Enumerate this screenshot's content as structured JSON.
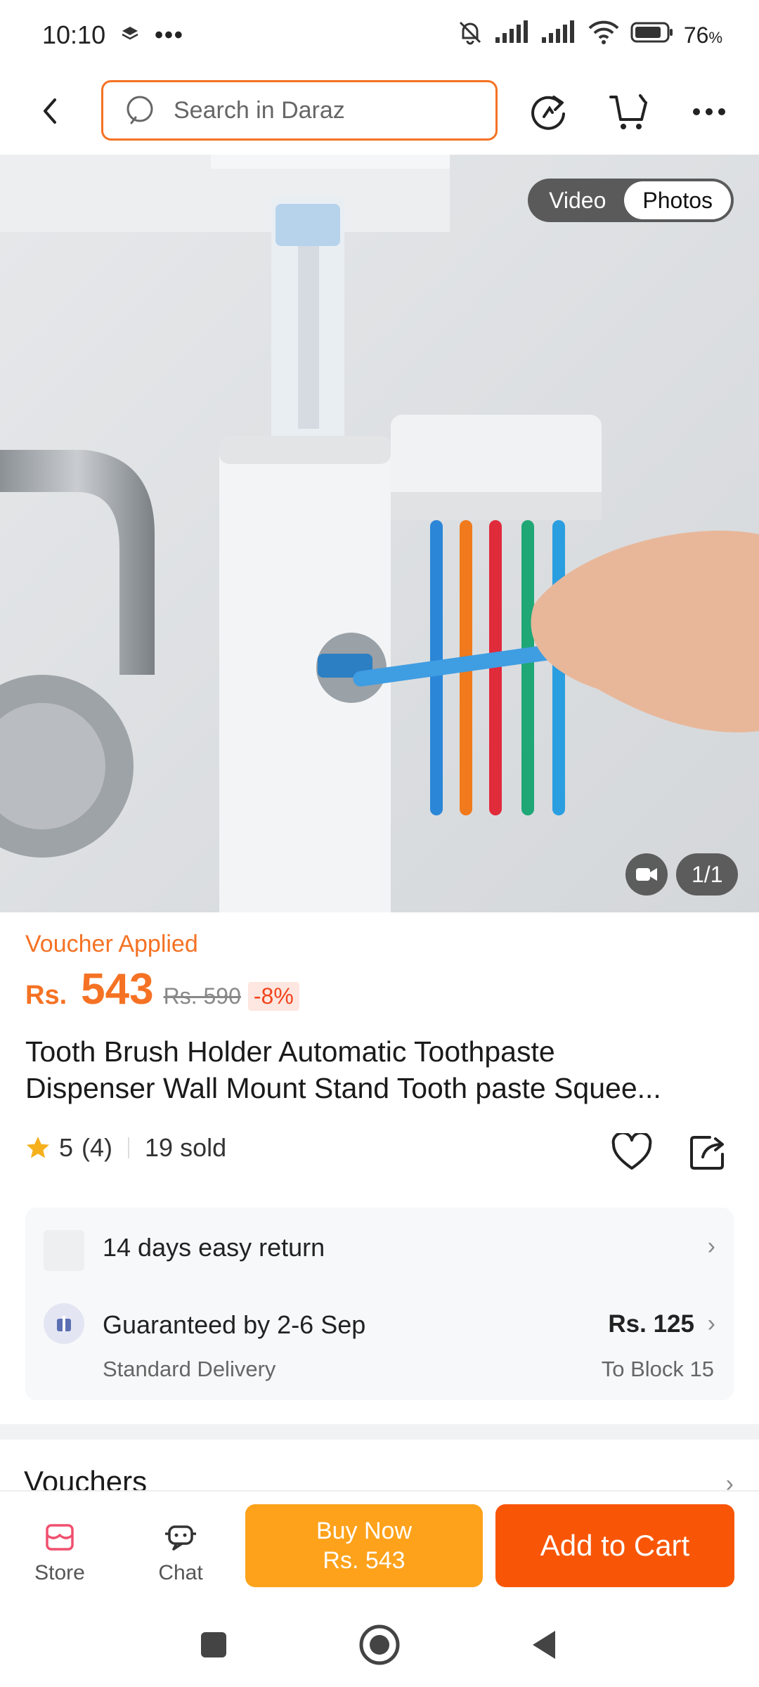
{
  "status_bar": {
    "time": "10:10",
    "battery": "76"
  },
  "search": {
    "placeholder": "Search in Daraz"
  },
  "gallery": {
    "media_tabs": [
      "Video",
      "Photos"
    ],
    "active_tab": "Photos",
    "counter": "1/1",
    "image_description_icons": [
      "back-icon",
      "refresh-icon",
      "cart-icon",
      "more-icon"
    ]
  },
  "product": {
    "voucher_label": "Voucher Applied",
    "currency": "Rs.",
    "price": "543",
    "original_price": "Rs. 590",
    "discount": "-8%",
    "title_line1": "Tooth Brush Holder Automatic Toothpaste",
    "title_line2": "Dispenser Wall Mount Stand Tooth paste Squee...",
    "rating": "5",
    "review_count": "(4)",
    "sold": "19 sold"
  },
  "services": {
    "return_policy": "14 days easy return",
    "delivery_guarantee": "Guaranteed by 2-6 Sep",
    "delivery_type": "Standard Delivery",
    "delivery_fee": "Rs. 125",
    "delivery_destination": "To Block 15"
  },
  "sections": {
    "vouchers": "Vouchers"
  },
  "action_bar": {
    "store_label": "Store",
    "chat_label": "Chat",
    "buy_now_label": "Buy Now",
    "buy_now_price": "Rs. 543",
    "add_to_cart_label": "Add to Cart"
  },
  "colors": {
    "accent": "#f57224",
    "buy_now": "#fea21b",
    "add_to_cart": "#f85606",
    "star": "#f6b01e"
  }
}
